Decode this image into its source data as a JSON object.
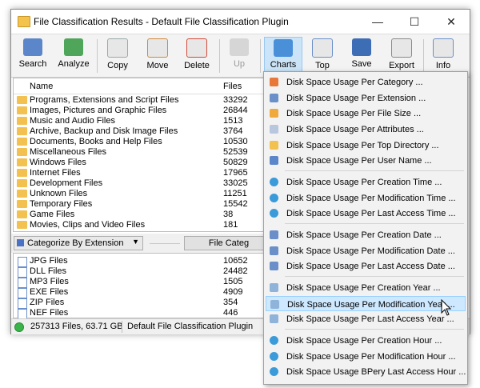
{
  "window": {
    "title": "File Classification Results - Default File Classification Plugin",
    "controls": {
      "minimize": "—",
      "maximize": "☐",
      "close": "✕"
    }
  },
  "toolbar": {
    "search": "Search",
    "analyze": "Analyze",
    "copy": "Copy",
    "move": "Move",
    "delete": "Delete",
    "up": "Up",
    "charts": "Charts",
    "top_files": "Top Files",
    "save": "Save",
    "export": "Export",
    "info": "Info"
  },
  "upper_list": {
    "col_name": "Name",
    "col_files": "Files",
    "rows": [
      {
        "name": "Programs, Extensions and Script Files",
        "files": "33292"
      },
      {
        "name": "Images, Pictures and Graphic Files",
        "files": "26844"
      },
      {
        "name": "Music and Audio Files",
        "files": "1513"
      },
      {
        "name": "Archive, Backup and Disk Image Files",
        "files": "3764"
      },
      {
        "name": "Documents, Books and Help Files",
        "files": "10530"
      },
      {
        "name": "Miscellaneous Files",
        "files": "52539"
      },
      {
        "name": "Windows Files",
        "files": "50829"
      },
      {
        "name": "Internet Files",
        "files": "17965"
      },
      {
        "name": "Development Files",
        "files": "33025"
      },
      {
        "name": "Unknown Files",
        "files": "11251"
      },
      {
        "name": "Temporary Files",
        "files": "15542"
      },
      {
        "name": "Game Files",
        "files": "38"
      },
      {
        "name": "Movies, Clips and Video Files",
        "files": "181"
      }
    ]
  },
  "midbar": {
    "categorize": "Categorize By Extension",
    "button": "File Categ"
  },
  "lower_list": {
    "rows": [
      {
        "name": "JPG Files",
        "files": "10652"
      },
      {
        "name": "DLL Files",
        "files": "24482"
      },
      {
        "name": "MP3 Files",
        "files": "1505"
      },
      {
        "name": "EXE Files",
        "files": "4909"
      },
      {
        "name": "ZIP Files",
        "files": "354"
      },
      {
        "name": "NEF Files",
        "files": "446"
      }
    ]
  },
  "status": {
    "summary": "257313 Files, 63.71 GB",
    "plugin": "Default File Classification Plugin"
  },
  "menu": {
    "items": [
      "Disk Space Usage Per Category ...",
      "Disk Space Usage Per Extension ...",
      "Disk Space Usage Per File Size ...",
      "Disk Space Usage Per Attributes ...",
      "Disk Space Usage Per Top Directory ...",
      "Disk Space Usage Per User Name ...",
      "Disk Space Usage Per Creation Time ...",
      "Disk Space Usage Per Modification Time ...",
      "Disk Space Usage Per Last Access Time ...",
      "Disk Space Usage Per Creation Date ...",
      "Disk Space Usage Per Modification Date ...",
      "Disk Space Usage Per Last Access Date ...",
      "Disk Space Usage Per Creation Year ...",
      "Disk Space Usage Per Modification Year ...",
      "Disk Space Usage Per Last Access Year ...",
      "Disk Space Usage Per Creation Hour ...",
      "Disk Space Usage Per Modification Hour ...",
      "Disk Space Usage BPery Last Access Hour ..."
    ],
    "highlighted_index": 13
  },
  "colors": {
    "accent": "#cce4f7",
    "highlight": "#cde8ff",
    "folder": "#f2c150",
    "status_ok": "#3bb54a"
  }
}
